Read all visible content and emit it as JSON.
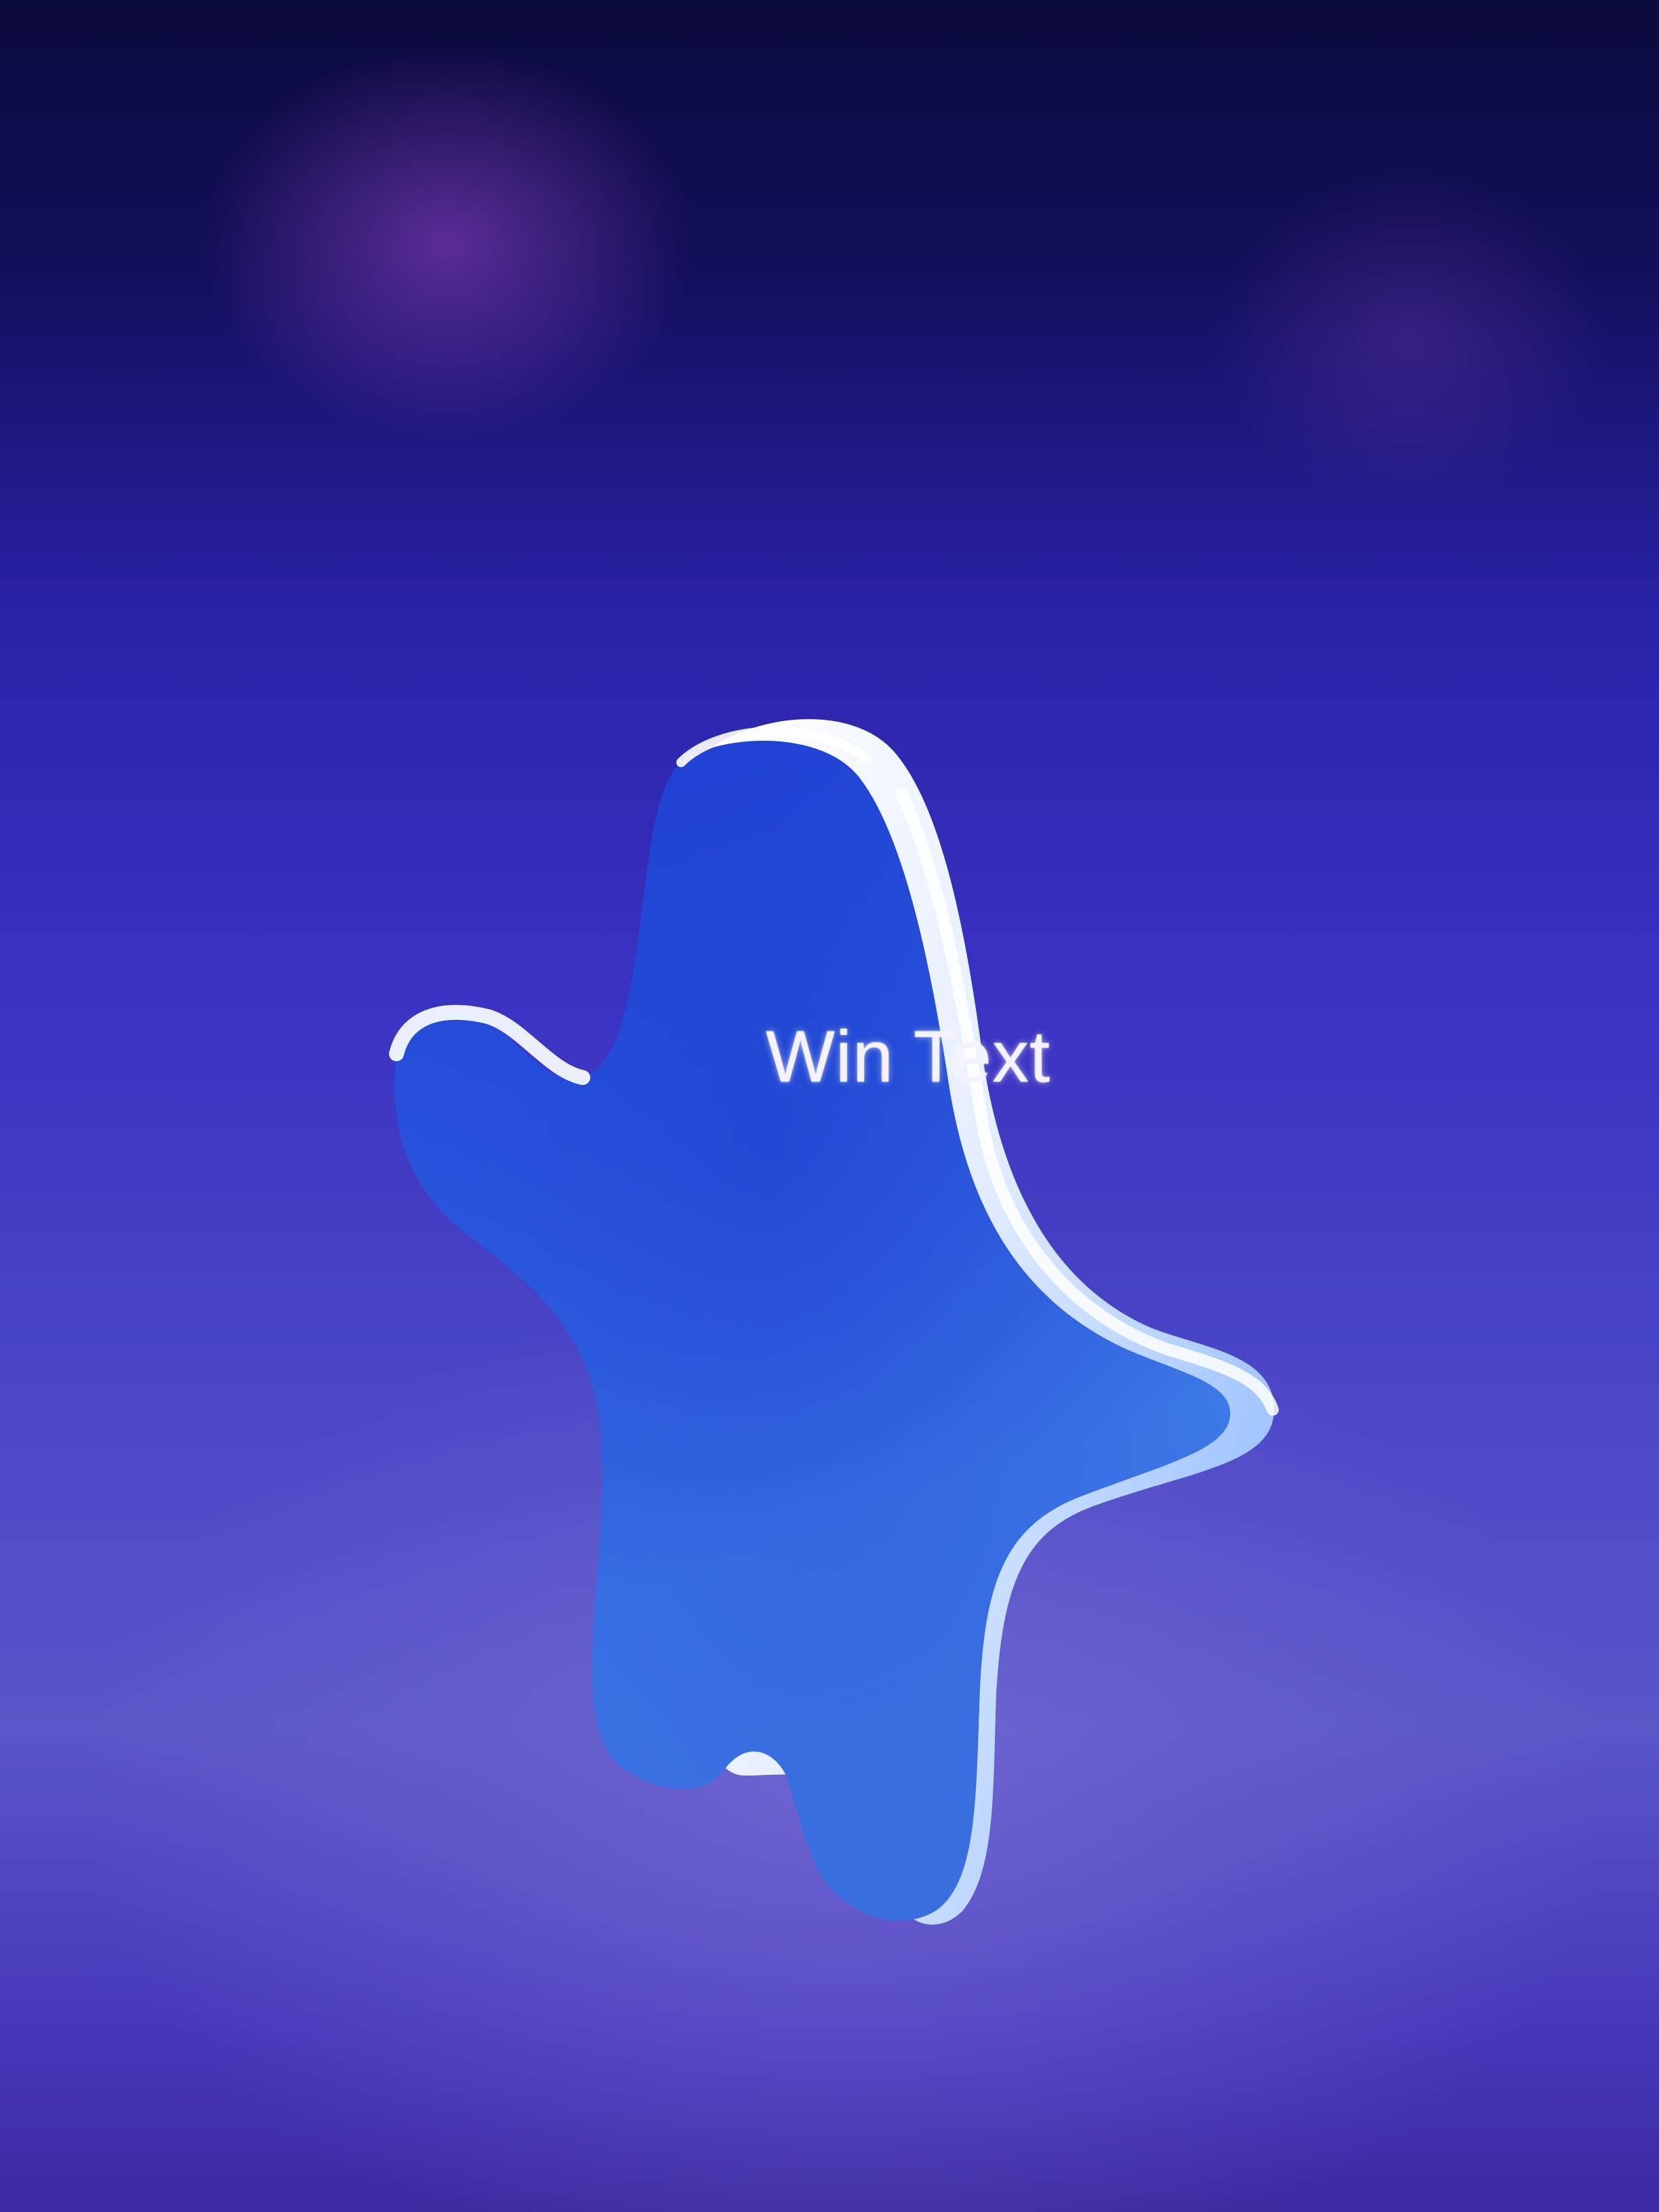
{
  "game": {
    "win_text": "Win Text"
  },
  "colors": {
    "background_top": "#0b0a3c",
    "background_mid": "#3a32c2",
    "background_bottom": "#5a56c8",
    "mascot_front": "#2f63e0",
    "mascot_highlight": "#f2f6ff",
    "text": "#f4f2ff"
  },
  "icons": {
    "mascot": "star-ghost-mascot-3d"
  }
}
